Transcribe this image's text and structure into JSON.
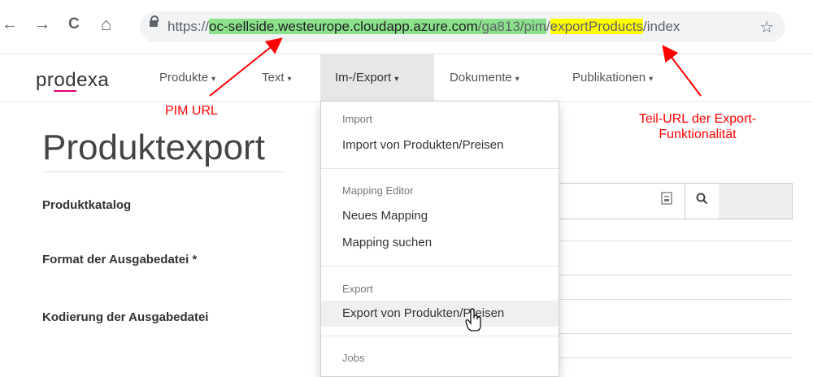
{
  "browser": {
    "back": "←",
    "forward": "→",
    "reload": "C",
    "home": "⌂",
    "url_prefix": "https://",
    "url_host": "oc-sellside.westeurope.cloudapp.azure.com",
    "url_path": "/ga813/pim",
    "url_slash": "/",
    "url_export": "exportProducts",
    "url_suffix": "/index",
    "bookmark": "☆"
  },
  "app": {
    "logo_pre": "pr",
    "logo_o": "o",
    "logo_d": "d",
    "logo_e": "e",
    "logo_post": "xa"
  },
  "nav": {
    "items": [
      {
        "label": "Produkte"
      },
      {
        "label": "Text"
      },
      {
        "label": "Im-/Export"
      },
      {
        "label": "Dokumente"
      },
      {
        "label": "Publikationen"
      }
    ],
    "caret": "▾"
  },
  "page": {
    "title": "Produktexport",
    "fields": [
      {
        "label": "Produktkatalog"
      },
      {
        "label": "Format der Ausgabedatei *"
      },
      {
        "label": "Kodierung der Ausgabedatei"
      }
    ]
  },
  "dropdown": {
    "sections": [
      {
        "header": "Import",
        "items": [
          "Import von Produkten/Preisen"
        ]
      },
      {
        "header": "Mapping Editor",
        "items": [
          "Neues Mapping",
          "Mapping suchen"
        ]
      },
      {
        "header": "Export",
        "items": [
          "Export von Produkten/Preisen"
        ]
      },
      {
        "header": "Jobs",
        "items": []
      }
    ]
  },
  "annotations": {
    "pim_url": "PIM URL",
    "export_url_line1": "Teil-URL der Export-",
    "export_url_line2": "Funktionalität",
    "color": "#ff0000"
  },
  "icons": [
    "lock-icon",
    "star-icon",
    "catalog-icon",
    "search-icon",
    "hand-cursor-icon"
  ]
}
